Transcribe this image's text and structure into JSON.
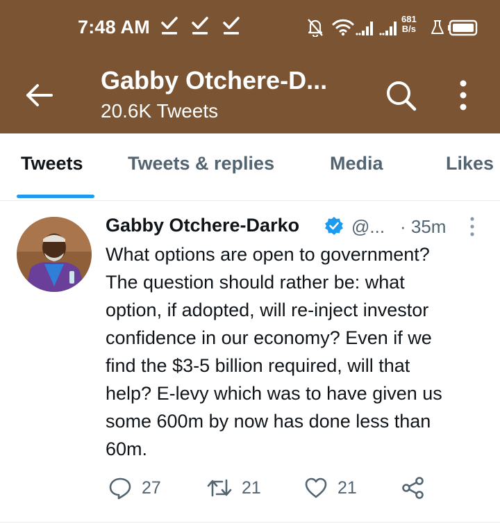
{
  "status_bar": {
    "time": "7:48 AM",
    "net_speed_value": "681",
    "net_speed_unit": "B/s",
    "icons": [
      "check-icon",
      "check-icon",
      "check-icon",
      "notifications-off-icon",
      "wifi-icon",
      "signal-icon",
      "signal-icon",
      "flask-icon",
      "battery-icon"
    ]
  },
  "header": {
    "name": "Gabby Otchere-D...",
    "tweet_count": "20.6K Tweets",
    "background_color": "#7a5433"
  },
  "tabs": [
    {
      "label": "Tweets",
      "active": true
    },
    {
      "label": "Tweets & replies",
      "active": false
    },
    {
      "label": "Media",
      "active": false
    },
    {
      "label": "Likes",
      "active": false
    }
  ],
  "tweet": {
    "author_name": "Gabby Otchere-Darko",
    "verified": true,
    "handle": "@...",
    "time": "· 35m",
    "text": "What options are open to government?\nThe question should rather be: what\noption, if adopted, will re-inject investor\nconfidence in our economy? Even if we\nfind the $3-5 billion required, will that\nhelp? E-levy which was to have given us\nsome 600m by now has done less than\n60m.",
    "replies": "27",
    "retweets": "21",
    "likes": "21"
  },
  "colors": {
    "accent": "#1d9bf0",
    "secondary_text": "#536471",
    "primary_text": "#0f1419"
  }
}
